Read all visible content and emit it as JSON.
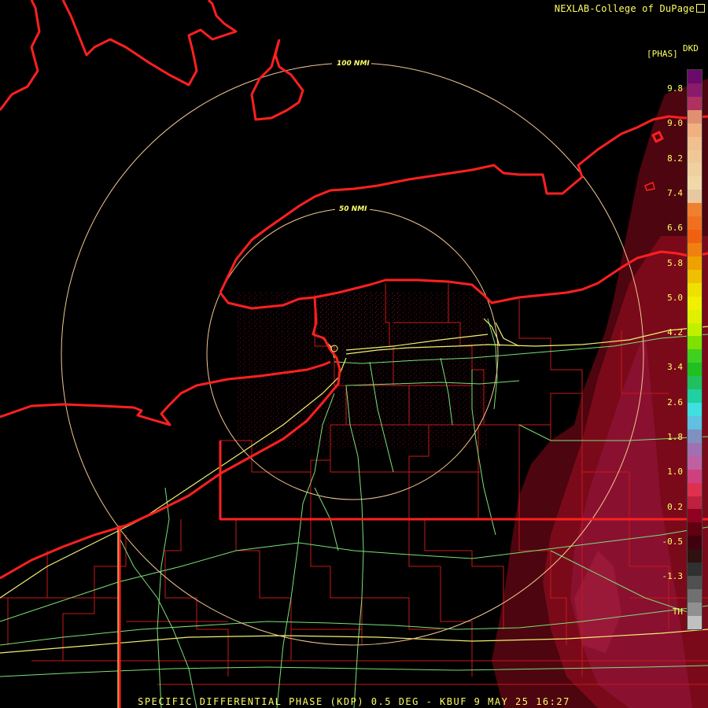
{
  "credit": "NEXLAB-College of DuPage",
  "credit_icon": "external-link-icon",
  "footer": "SPECIFIC DIFFERENTIAL PHASE (KDP) 0.5 DEG - KBUF 9 MAY 25 16:27",
  "legend": {
    "product": "DKD",
    "unit": "[PHAS]",
    "ticks": [
      "9.8",
      "9.0",
      "8.2",
      "7.4",
      "6.6",
      "5.8",
      "5.0",
      "4.2",
      "3.4",
      "2.6",
      "1.8",
      "1.0",
      "0.2",
      "-0.5",
      "-1.3",
      "TH"
    ],
    "colors": [
      "#6a0a6a",
      "#8a1a6a",
      "#b03060",
      "#e09070",
      "#f0b080",
      "#f0c090",
      "#f0c898",
      "#f0d0a0",
      "#f0d8a8",
      "#e8c8a0",
      "#f08030",
      "#f07020",
      "#f06010",
      "#f08010",
      "#f0a000",
      "#f0c000",
      "#f0e000",
      "#f0f000",
      "#e0f000",
      "#c0f000",
      "#80e000",
      "#40d020",
      "#20c020",
      "#20c060",
      "#20d0a0",
      "#40e0e0",
      "#60c0e0",
      "#8090c0",
      "#a070b0",
      "#c060a0",
      "#d04080",
      "#e03050",
      "#c02040",
      "#900020",
      "#600010",
      "#400010",
      "#301010",
      "#303030",
      "#505050",
      "#707070",
      "#909090",
      "#c0c0c0"
    ]
  },
  "map": {
    "range_rings": [
      "100 NMI",
      "50 NMI"
    ],
    "colors": {
      "coast": "#ff2020",
      "county": "#d01818",
      "state": "#ff2020",
      "highway": "#f0f070",
      "road": "#70e070",
      "ring": "#f0c890",
      "precip": "#7a0a1a"
    }
  }
}
